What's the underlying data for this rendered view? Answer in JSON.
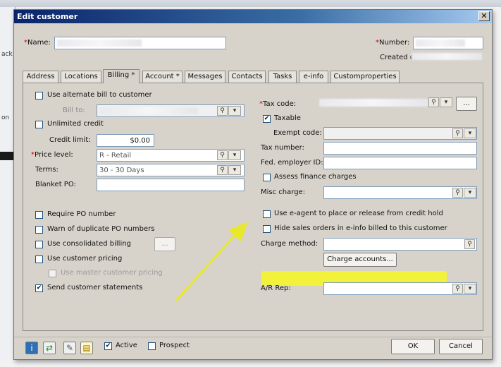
{
  "background": {
    "fragments": [
      "ack",
      "on"
    ]
  },
  "dialog": {
    "title": "Edit customer",
    "close_glyph": "✕",
    "name_label": "Name:",
    "number_label": "Number:",
    "created_label": "Created o",
    "tabs": [
      "Address",
      "Locations",
      "Billing *",
      "Account *",
      "Messages",
      "Contacts",
      "Tasks",
      "e-info",
      "Customproperties"
    ],
    "active_tab": "Billing *"
  },
  "billing": {
    "use_alternate_bill_label": "Use alternate bill to customer",
    "bill_to_label": "Bill to:",
    "unlimited_credit_label": "Unlimited credit",
    "credit_limit_label": "Credit limit:",
    "credit_limit_value": "$0.00",
    "price_level_label": "Price level:",
    "price_level_value": "R - Retail",
    "terms_label": "Terms:",
    "terms_value": "30 - 30 Days",
    "blanket_po_label": "Blanket PO:",
    "require_po_label": "Require PO number",
    "warn_dup_po_label": "Warn of duplicate PO numbers",
    "consolidated_billing_label": "Use consolidated billing",
    "consolidated_btn": "...",
    "customer_pricing_label": "Use customer pricing",
    "master_pricing_label": "Use master customer pricing",
    "send_statements_label": "Send customer statements",
    "tax_code_label": "Tax code:",
    "tax_code_btn": "...",
    "taxable_label": "Taxable",
    "exempt_code_label": "Exempt code:",
    "tax_number_label": "Tax number:",
    "fed_employer_label": "Fed. employer ID:",
    "assess_finance_label": "Assess finance charges",
    "misc_charge_label": "Misc charge:",
    "eagent_label": "Use e-agent to place or release from credit hold",
    "hide_sales_label": "Hide sales orders in e-info billed to this customer",
    "charge_method_label": "Charge method:",
    "charge_accounts_btn": "Charge accounts...",
    "ar_rep_label": "A/R Rep:"
  },
  "checkbox_state": {
    "use_alternate_bill": false,
    "unlimited_credit": false,
    "require_po": false,
    "warn_dup_po": false,
    "consolidated_billing": false,
    "customer_pricing": false,
    "master_pricing": false,
    "send_statements": true,
    "taxable": true,
    "assess_finance": false,
    "eagent": false,
    "hide_sales": false,
    "active": true,
    "prospect": false
  },
  "footer": {
    "active_label": "Active",
    "prospect_label": "Prospect",
    "ok_label": "OK",
    "cancel_label": "Cancel",
    "icons": [
      "info-icon",
      "transfer-icon",
      "attach-icon",
      "notes-icon"
    ]
  },
  "colors": {
    "highlight": "#f2f23a",
    "arrow": "#e8e82a",
    "title_start": "#0a246a",
    "title_end": "#a6caf0"
  },
  "check_glyph": "✔",
  "picker_glyphs": {
    "search": "⚲",
    "drop": "▾"
  }
}
